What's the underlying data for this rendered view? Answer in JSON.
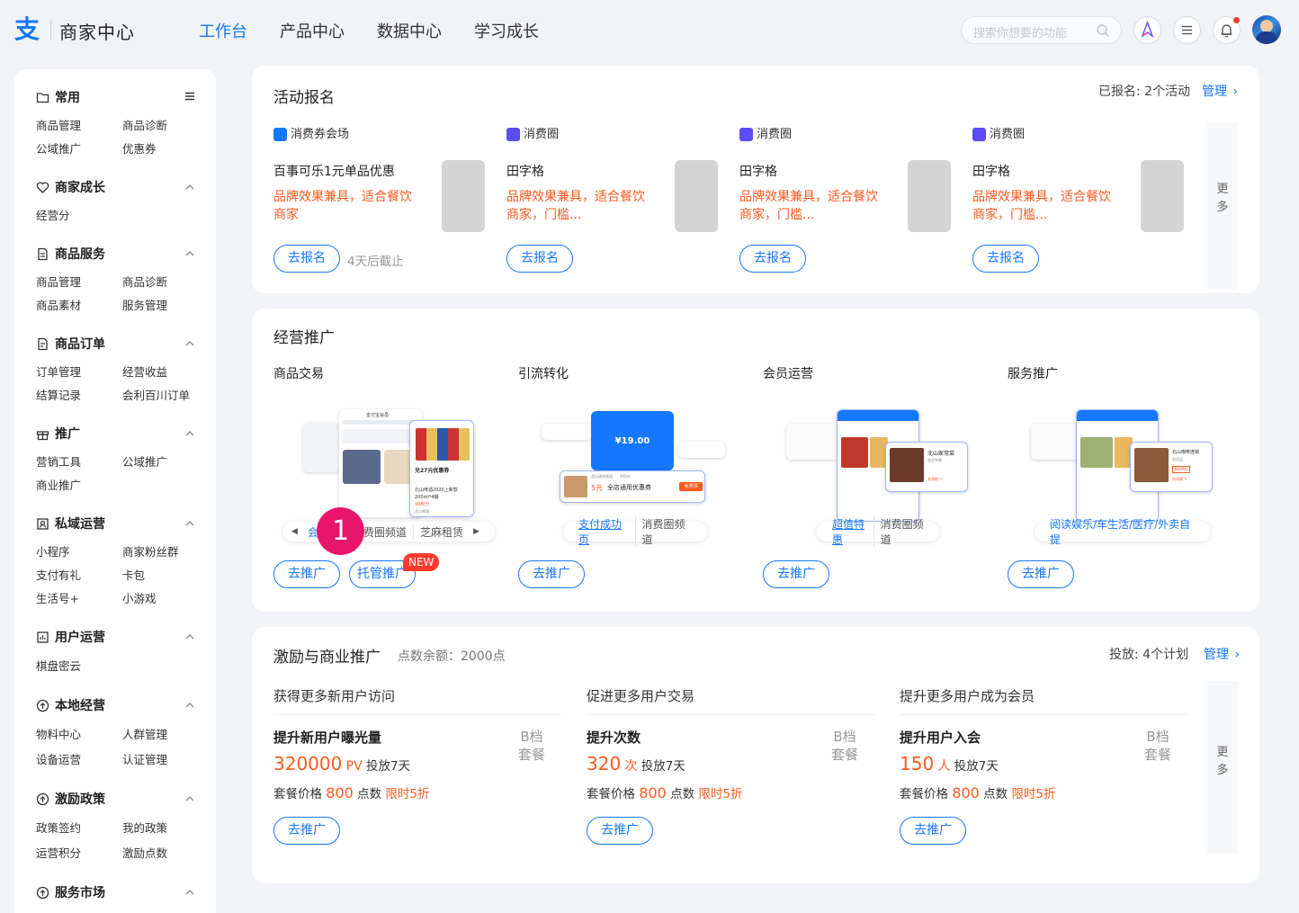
{
  "header": {
    "logo_glyph": "支",
    "brand": "商家中心",
    "nav": [
      "工作台",
      "产品中心",
      "数据中心",
      "学习成长"
    ],
    "search_placeholder": "搜索你想要的功能"
  },
  "sidebar": {
    "sections": [
      {
        "title": "常用",
        "items": [
          "商品管理",
          "商品诊断",
          "公域推广",
          "优惠券"
        ]
      },
      {
        "title": "商家成长",
        "items": [
          "经营分"
        ]
      },
      {
        "title": "商品服务",
        "items": [
          "商品管理",
          "商品诊断",
          "商品素材",
          "服务管理"
        ]
      },
      {
        "title": "商品订单",
        "items": [
          "订单管理",
          "经营收益",
          "结算记录",
          "会利百川订单"
        ]
      },
      {
        "title": "推广",
        "items": [
          "营销工具",
          "公域推广",
          "商业推广"
        ]
      },
      {
        "title": "私域运营",
        "items": [
          "小程序",
          "商家粉丝群",
          "支付有礼",
          "卡包",
          "生活号+",
          "小游戏"
        ]
      },
      {
        "title": "用户运营",
        "items": [
          "棋盘密云"
        ]
      },
      {
        "title": "本地经营",
        "items": [
          "物料中心",
          "人群管理",
          "设备运营",
          "认证管理"
        ]
      },
      {
        "title": "激励政策",
        "items": [
          "政策签约",
          "我的政策",
          "运营积分",
          "激励点数"
        ]
      },
      {
        "title": "服务市场",
        "items": []
      }
    ]
  },
  "activity": {
    "title": "活动报名",
    "registered_label": "已报名:",
    "registered_value": "2个活动",
    "manage": "管理",
    "more": "更多",
    "cards": [
      {
        "tag": "消费券会场",
        "name": "百事可乐1元单品优惠",
        "desc1": "品牌效果兼具，适合餐饮",
        "desc2": "商家",
        "button": "去报名",
        "note": "4天后截止"
      },
      {
        "tag": "消费圈",
        "name": "田字格",
        "desc1": "品牌效果兼具，适合餐饮",
        "desc2": "商家，门槛...",
        "button": "去报名",
        "note": ""
      },
      {
        "tag": "消费圈",
        "name": "田字格",
        "desc1": "品牌效果兼具，适合餐饮",
        "desc2": "商家，门槛...",
        "button": "去报名",
        "note": ""
      },
      {
        "tag": "消费圈",
        "name": "田字格",
        "desc1": "品牌效果兼具，适合餐饮",
        "desc2": "商家，门槛...",
        "button": "去报名",
        "note": ""
      }
    ]
  },
  "promo": {
    "title": "经营推广",
    "columns": [
      {
        "head": "商品交易",
        "tabs": [
          "会",
          "消费圈频道",
          "芝麻租赁"
        ],
        "buttons": [
          "去推广",
          "托管推广"
        ],
        "new_badge": "NEW",
        "step": "1",
        "mock": {
          "header": "支付宝会员",
          "card_title": "兑27元优惠券",
          "card_line1": "北山啤酒2020上新款",
          "card_line2": "200ml*4罐",
          "card_points": "99积分",
          "store": "北山啤酒"
        }
      },
      {
        "head": "引流转化",
        "tabs": [
          "支付成功页",
          "消费圈频道"
        ],
        "buttons": [
          "去推广"
        ],
        "mock": {
          "amount": "¥19.00",
          "coupon_store": "北山清扬频道",
          "coupon_dist": "300m",
          "coupon_value": "5元",
          "coupon_desc": "全店通用优惠券",
          "coupon_cta": "免费领"
        }
      },
      {
        "head": "会员运营",
        "tabs": [
          "超值特惠",
          "消费圈频道"
        ],
        "buttons": [
          "去推广"
        ],
        "mock": {
          "store": "北山家常菜",
          "sub": "会员专属",
          "cta": "去领取 >"
        }
      },
      {
        "head": "服务推广",
        "tabs": [
          "阅读娱乐/车生活/医疗/外卖自提"
        ],
        "buttons": [
          "去推广"
        ],
        "mock": {
          "store": "北山咖啡连锁",
          "sub": "会员店",
          "tag": "限时特价",
          "cta": "去详情 >"
        }
      }
    ]
  },
  "incentive": {
    "title": "激励与商业推广",
    "balance": "点数余额：2000点",
    "delivered_label": "投放:",
    "delivered_value": "4个计划",
    "manage": "管理",
    "more": "更多",
    "columns": [
      {
        "head": "获得更多新用户访问",
        "name": "提升新用户曝光量",
        "tier": "B档",
        "tier_sub": "套餐",
        "value": "320000",
        "unit": "PV",
        "duration": "投放7天",
        "price_label": "套餐价格",
        "price": "800",
        "price_unit": "点数",
        "promo": "限时5折",
        "button": "去推广"
      },
      {
        "head": "促进更多用户交易",
        "name": "提升次数",
        "tier": "B档",
        "tier_sub": "套餐",
        "value": "320",
        "unit": "次",
        "duration": "投放7天",
        "price_label": "套餐价格",
        "price": "800",
        "price_unit": "点数",
        "promo": "限时5折",
        "button": "去推广"
      },
      {
        "head": "提升更多用户成为会员",
        "name": "提升用户入会",
        "tier": "B档",
        "tier_sub": "套餐",
        "value": "150",
        "unit": "人",
        "duration": "投放7天",
        "price_label": "套餐价格",
        "price": "800",
        "price_unit": "点数",
        "promo": "限时5折",
        "button": "去推广"
      }
    ]
  },
  "colors": {
    "accent": "#1677ff",
    "orange": "#ff5a1f",
    "badge_red": "#ff3b30",
    "step_pink": "#e8156b"
  }
}
